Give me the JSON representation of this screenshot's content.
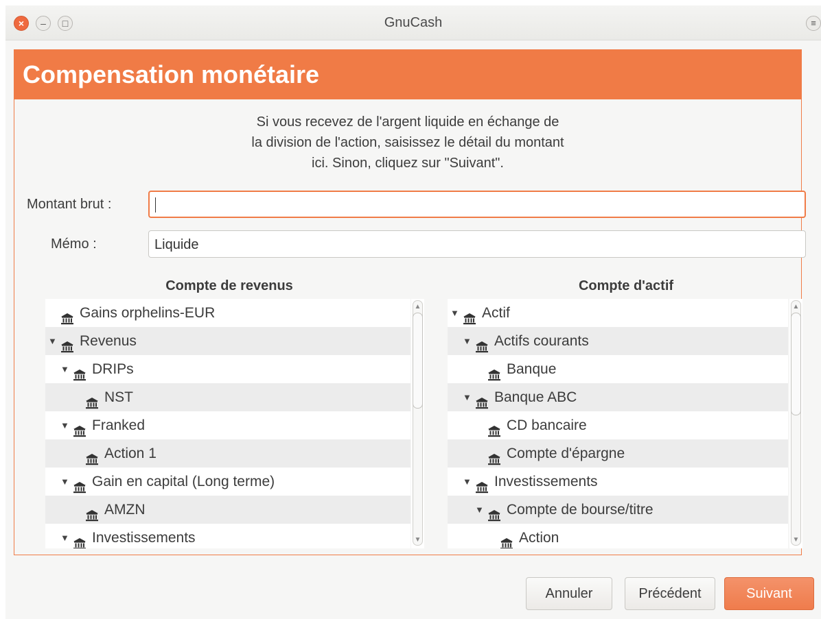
{
  "window": {
    "title": "GnuCash"
  },
  "page": {
    "heading": "Compensation monétaire",
    "description": [
      "Si vous recevez de l'argent liquide en échange de",
      "la division de l'action, saisissez le détail du montant",
      "ici. Sinon, cliquez sur \"Suivant\"."
    ],
    "gross_label": "Montant brut :",
    "gross_value": "",
    "memo_label": "Mémo :",
    "memo_value": "Liquide"
  },
  "income": {
    "header": "Compte de revenus",
    "rows": [
      {
        "label": "Gains orphelins-EUR",
        "expander": ""
      },
      {
        "label": "Revenus",
        "expander": "▼"
      },
      {
        "label": "DRIPs",
        "expander": "▼"
      },
      {
        "label": "NST",
        "expander": ""
      },
      {
        "label": "Franked",
        "expander": "▼"
      },
      {
        "label": "Action 1",
        "expander": ""
      },
      {
        "label": "Gain en capital (Long terme)",
        "expander": "▼"
      },
      {
        "label": "AMZN",
        "expander": ""
      },
      {
        "label": "Investissements",
        "expander": "▼"
      }
    ]
  },
  "asset": {
    "header": "Compte d'actif",
    "rows": [
      {
        "label": "Actif",
        "expander": "▼"
      },
      {
        "label": "Actifs courants",
        "expander": "▼"
      },
      {
        "label": "Banque",
        "expander": ""
      },
      {
        "label": "Banque ABC",
        "expander": "▼"
      },
      {
        "label": "CD bancaire",
        "expander": ""
      },
      {
        "label": "Compte d'épargne",
        "expander": ""
      },
      {
        "label": "Investissements",
        "expander": "▼"
      },
      {
        "label": "Compte de bourse/titre",
        "expander": "▼"
      },
      {
        "label": "Action",
        "expander": ""
      }
    ]
  },
  "buttons": {
    "cancel": "Annuler",
    "back": "Précédent",
    "next": "Suivant"
  },
  "colors": {
    "accent": "#f07b46"
  }
}
